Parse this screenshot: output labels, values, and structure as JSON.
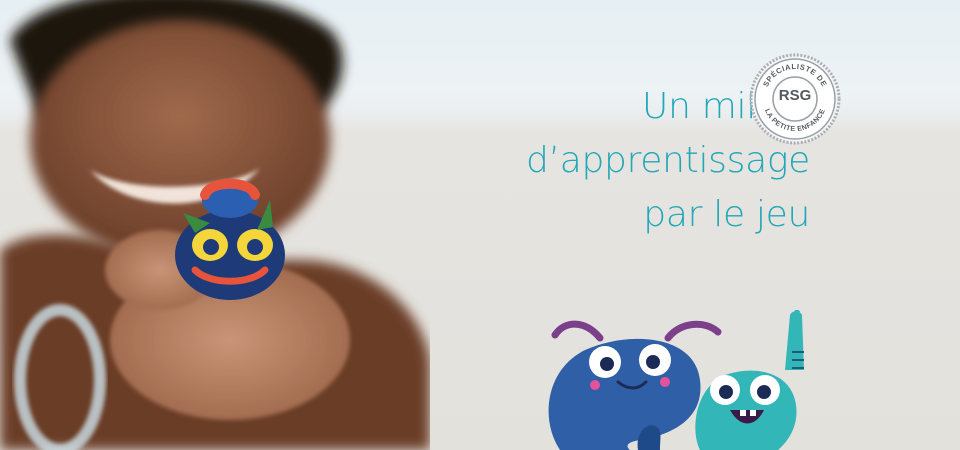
{
  "hero": {
    "headline": {
      "line1": "Un milieu",
      "line2": "d’apprentissage",
      "line3": "par le jeu"
    },
    "badge": {
      "top_text": "SPÉCIALISTE DE",
      "center_text": "RSG",
      "bottom_text": "LA PETITE ENFANCE"
    },
    "accent_color": "#21a7b6",
    "badge_color": "#9aa1a6"
  }
}
